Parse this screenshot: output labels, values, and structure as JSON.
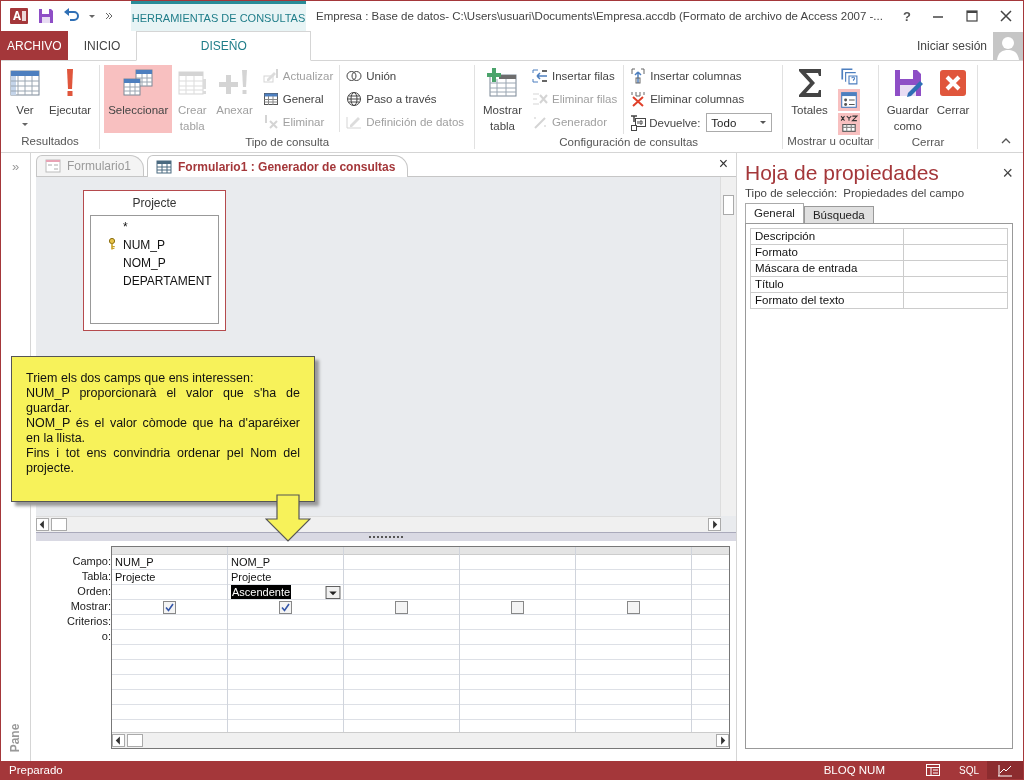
{
  "title_bar": {
    "context_tab": "HERRAMIENTAS DE CONSULTAS",
    "title": "Empresa : Base de datos- C:\\Users\\usuari\\Documents\\Empresa.accdb (Formato de archivo de Access 2007 -...",
    "help": "?"
  },
  "ribbon_tabs": [
    {
      "label": "ARCHIVO",
      "kind": "file",
      "selected": false
    },
    {
      "label": "INICIO",
      "kind": "tab",
      "selected": false
    },
    {
      "label": "DISEÑO",
      "kind": "context",
      "selected": true
    }
  ],
  "sign_in": "Iniciar sesión",
  "ribbon": {
    "groups": [
      {
        "label": "Resultados",
        "large": [
          {
            "label": "Ver",
            "dropdown": true,
            "disabled": false,
            "selected": false
          },
          {
            "label": "Ejecutar",
            "disabled": false,
            "selected": false
          }
        ]
      },
      {
        "label": "Tipo de consulta",
        "large": [
          {
            "label": "Seleccionar",
            "disabled": false,
            "selected": true
          },
          {
            "label": "Crear tabla",
            "disabled": true,
            "selected": false
          },
          {
            "label": "Anexar",
            "disabled": true,
            "selected": false
          }
        ],
        "columns": [
          [
            {
              "kind": "small",
              "label": "Actualizar",
              "disabled": true
            },
            {
              "kind": "small",
              "label": "General",
              "disabled": false
            },
            {
              "kind": "small",
              "label": "Eliminar",
              "disabled": true
            }
          ],
          [
            {
              "kind": "small",
              "label": "Unión",
              "disabled": false
            },
            {
              "kind": "small",
              "label": "Paso a través",
              "disabled": false
            },
            {
              "kind": "small",
              "label": "Definición de datos",
              "disabled": true
            }
          ]
        ]
      },
      {
        "label": "Configuración de consultas",
        "large": [
          {
            "label": "Mostrar tabla",
            "disabled": false,
            "selected": false
          }
        ],
        "columns": [
          [
            {
              "kind": "small",
              "label": "Insertar filas",
              "disabled": false
            },
            {
              "kind": "small",
              "label": "Eliminar filas",
              "disabled": true
            },
            {
              "kind": "small",
              "label": "Generador",
              "disabled": true
            }
          ],
          [
            {
              "kind": "small",
              "label": "Insertar columnas",
              "disabled": false
            },
            {
              "kind": "small",
              "label": "Eliminar columnas",
              "disabled": false
            },
            {
              "kind": "combo",
              "label": "Devuelve:",
              "value": "Todo"
            }
          ]
        ]
      },
      {
        "label": "Mostrar u ocultar",
        "large": [
          {
            "label": "Totales",
            "disabled": false,
            "selected": false
          }
        ],
        "columns": [
          [
            {
              "kind": "icon",
              "selected": false
            },
            {
              "kind": "icon",
              "selected": true
            },
            {
              "kind": "icon",
              "selected": true
            }
          ]
        ]
      },
      {
        "label": "Cerrar",
        "large": [
          {
            "label": "Guardar como",
            "disabled": false,
            "selected": false
          },
          {
            "label": "Cerrar",
            "disabled": false,
            "selected": false
          }
        ]
      }
    ]
  },
  "nav_pane": {
    "expand": "»",
    "label": "Pane"
  },
  "doc_tabs": [
    {
      "label": "Formulario1",
      "selected": false
    },
    {
      "label": "Formulario1 : Generador de consultas",
      "selected": true
    }
  ],
  "doc_close": "×",
  "field_list": {
    "title": "Projecte",
    "fields": [
      {
        "name": "*",
        "key": false
      },
      {
        "name": "NUM_P",
        "key": true
      },
      {
        "name": "NOM_P",
        "key": false
      },
      {
        "name": "DEPARTAMENT",
        "key": false
      }
    ]
  },
  "callout": [
    "Triem els dos camps que ens interessen:",
    "NUM_P proporcionarà el valor que s'ha de guardar.",
    "NOM_P és el valor còmode que ha d'aparéixer en la llista.",
    "Fins i tot ens convindria ordenar pel Nom del projecte."
  ],
  "query_grid": {
    "row_labels": [
      "Campo:",
      "Tabla:",
      "Orden:",
      "Mostrar:",
      "Criterios:",
      "o:"
    ],
    "columns": [
      {
        "field": "NUM_P",
        "table": "Projecte",
        "show": true
      },
      {
        "field": "NOM_P",
        "table": "Projecte",
        "sort": "Ascendente",
        "sort_selected": true,
        "show": true
      },
      {
        "show": false
      },
      {
        "show": false
      },
      {
        "show": false
      }
    ]
  },
  "property_sheet": {
    "title": "Hoja de propiedades",
    "close": "×",
    "selection_label": "Tipo de selección:",
    "selection_value": "Propiedades del campo",
    "tabs": [
      {
        "label": "General",
        "selected": true
      },
      {
        "label": "Búsqueda",
        "selected": false
      }
    ],
    "properties": [
      "Descripción",
      "Formato",
      "Máscara de entrada",
      "Título",
      "Formato del texto"
    ]
  },
  "status_bar": {
    "text": "Preparado",
    "num_lock": "BLOQ NUM",
    "views": [
      {
        "kind": "datasheet",
        "selected": false
      },
      {
        "kind": "sql",
        "label": "SQL",
        "selected": false
      },
      {
        "kind": "design",
        "selected": true
      }
    ]
  }
}
